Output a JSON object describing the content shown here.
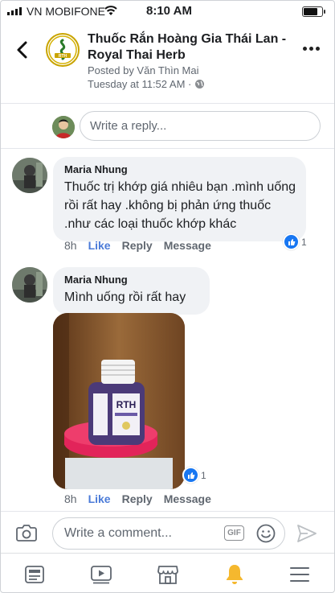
{
  "status_bar": {
    "carrier": "VN MOBIFONE",
    "time": "8:10 AM",
    "battery_level": 0.88
  },
  "header": {
    "page_title": "Thuốc Rắn Hoàng Gia Thái Lan - Royal Thai Herb",
    "posted_by": "Posted by Văn Thìn Mai",
    "timestamp": "Tuesday at 11:52 AM · ",
    "logo_text": "RTH"
  },
  "reply": {
    "placeholder": "Write a reply..."
  },
  "comments": [
    {
      "author": "Maria Nhung",
      "text": "Thuốc trị khớp giá nhiêu bạn .mình uống rồi rất hay .không bị phản ứng thuốc .như các loại thuốc khớp khác",
      "time": "8h",
      "like_label": "Like",
      "reply_label": "Reply",
      "message_label": "Message",
      "reaction_count": "1"
    },
    {
      "author": "Maria Nhung",
      "text": "Mình uống rồi rất hay",
      "time": "8h",
      "like_label": "Like",
      "reply_label": "Reply",
      "message_label": "Message",
      "reaction_count": "1",
      "photo_label": "RTH"
    }
  ],
  "composer": {
    "placeholder": "Write a comment...",
    "gif_label": "GIF"
  },
  "tab_bar": {
    "items": [
      "news-feed-icon",
      "watch-icon",
      "marketplace-icon",
      "notifications-icon",
      "menu-icon"
    ],
    "active": "notifications-icon"
  },
  "colors": {
    "link_blue": "#4b7bd8",
    "bubble_bg": "#f0f2f5",
    "active_tab": "#f5b82e"
  }
}
